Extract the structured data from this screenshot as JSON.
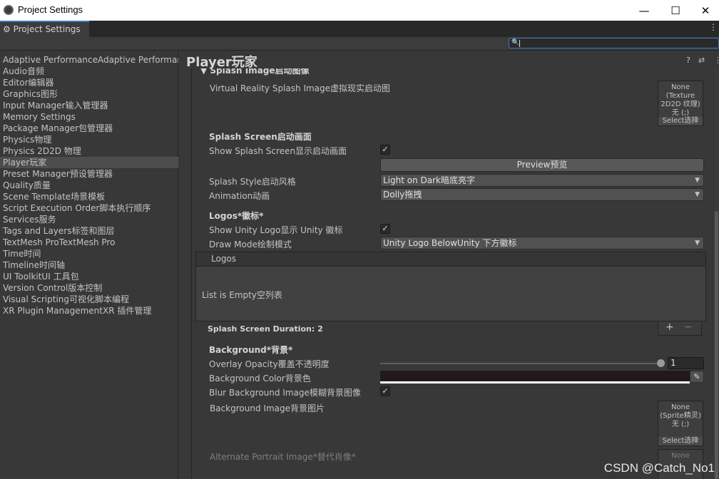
{
  "window": {
    "title": "Project Settings",
    "minimize": "—",
    "maximize": "☐",
    "close": "✕"
  },
  "tab": {
    "label": "⚙ Project Settings",
    "more": "⋮"
  },
  "search": {
    "icon": "🔍",
    "placeholder": ""
  },
  "sidebar": {
    "items": [
      {
        "label": "Adaptive PerformanceAdaptive Performanc"
      },
      {
        "label": "Audio音频"
      },
      {
        "label": "Editor编辑器"
      },
      {
        "label": "Graphics图形"
      },
      {
        "label": "Input Manager输入管理器"
      },
      {
        "label": "Memory Settings"
      },
      {
        "label": "Package Manager包管理器"
      },
      {
        "label": "Physics物理"
      },
      {
        "label": "Physics 2D2D 物理"
      },
      {
        "label": "Player玩家",
        "selected": true
      },
      {
        "label": "Preset Manager预设管理器"
      },
      {
        "label": "Quality质量"
      },
      {
        "label": "Scene Template场景模板"
      },
      {
        "label": "Script Execution Order脚本执行顺序"
      },
      {
        "label": "Services服务"
      },
      {
        "label": "Tags and Layers标签和图层"
      },
      {
        "label": "TextMesh ProTextMesh Pro"
      },
      {
        "label": "Time时间"
      },
      {
        "label": "Timeline时间轴"
      },
      {
        "label": "UI ToolkitUI 工具包"
      },
      {
        "label": "Version Control版本控制"
      },
      {
        "label": "Visual Scripting可视化脚本编程"
      },
      {
        "label": "XR Plugin ManagementXR 插件管理"
      }
    ]
  },
  "main": {
    "title": "Player玩家",
    "help_icon": "?",
    "settings_icon": "⇄",
    "more_icon": "⋮",
    "splash_image_header": "▼ Splash Image启动图像",
    "vr_splash_label": "Virtual Reality Splash Image虚拟现实启动图",
    "vr_thumb_text": "None (Texture 2D2D 纹理)无 (;)",
    "thumb_select": "Select选择",
    "splash_screen_header": "Splash Screen启动画面",
    "show_splash_label": "Show Splash Screen显示启动画面",
    "check_mark": "✓",
    "preview_button": "Preview预览",
    "splash_style_label": "Splash Style启动风格",
    "splash_style_value": "Light on Dark暗底亮字",
    "animation_label": "Animation动画",
    "animation_value": "Dolly拖拽",
    "dropdown_arrow": "▼",
    "logos_header": "Logos*徽标*",
    "show_unity_logo_label": "Show Unity Logo显示 Unity 徽标",
    "draw_mode_label": "Draw Mode绘制模式",
    "draw_mode_value": "Unity Logo BelowUnity 下方徽标",
    "logos_list_title": "Logos",
    "logos_empty": "List is Empty空列表",
    "add": "+",
    "remove": "−",
    "duration_label": "Splash Screen Duration: 2",
    "background_header": "Background*背景*",
    "overlay_label": "Overlay Opacity覆盖不透明度",
    "overlay_value": "1",
    "overlay_fraction": 1,
    "bg_color_label": "Background Color背景色",
    "bg_color": "#221a1a",
    "picker_icon": "✎",
    "blur_label": "Blur Background Image模糊背景图像",
    "bg_image_label": "Background Image背景图片",
    "bg_thumb_text": "None (Sprite精灵)无 (;)",
    "alt_portrait_label": "Alternate Portrait Image*替代肖像*",
    "alt_thumb_text": "None"
  },
  "watermark": "CSDN @Catch_No1"
}
